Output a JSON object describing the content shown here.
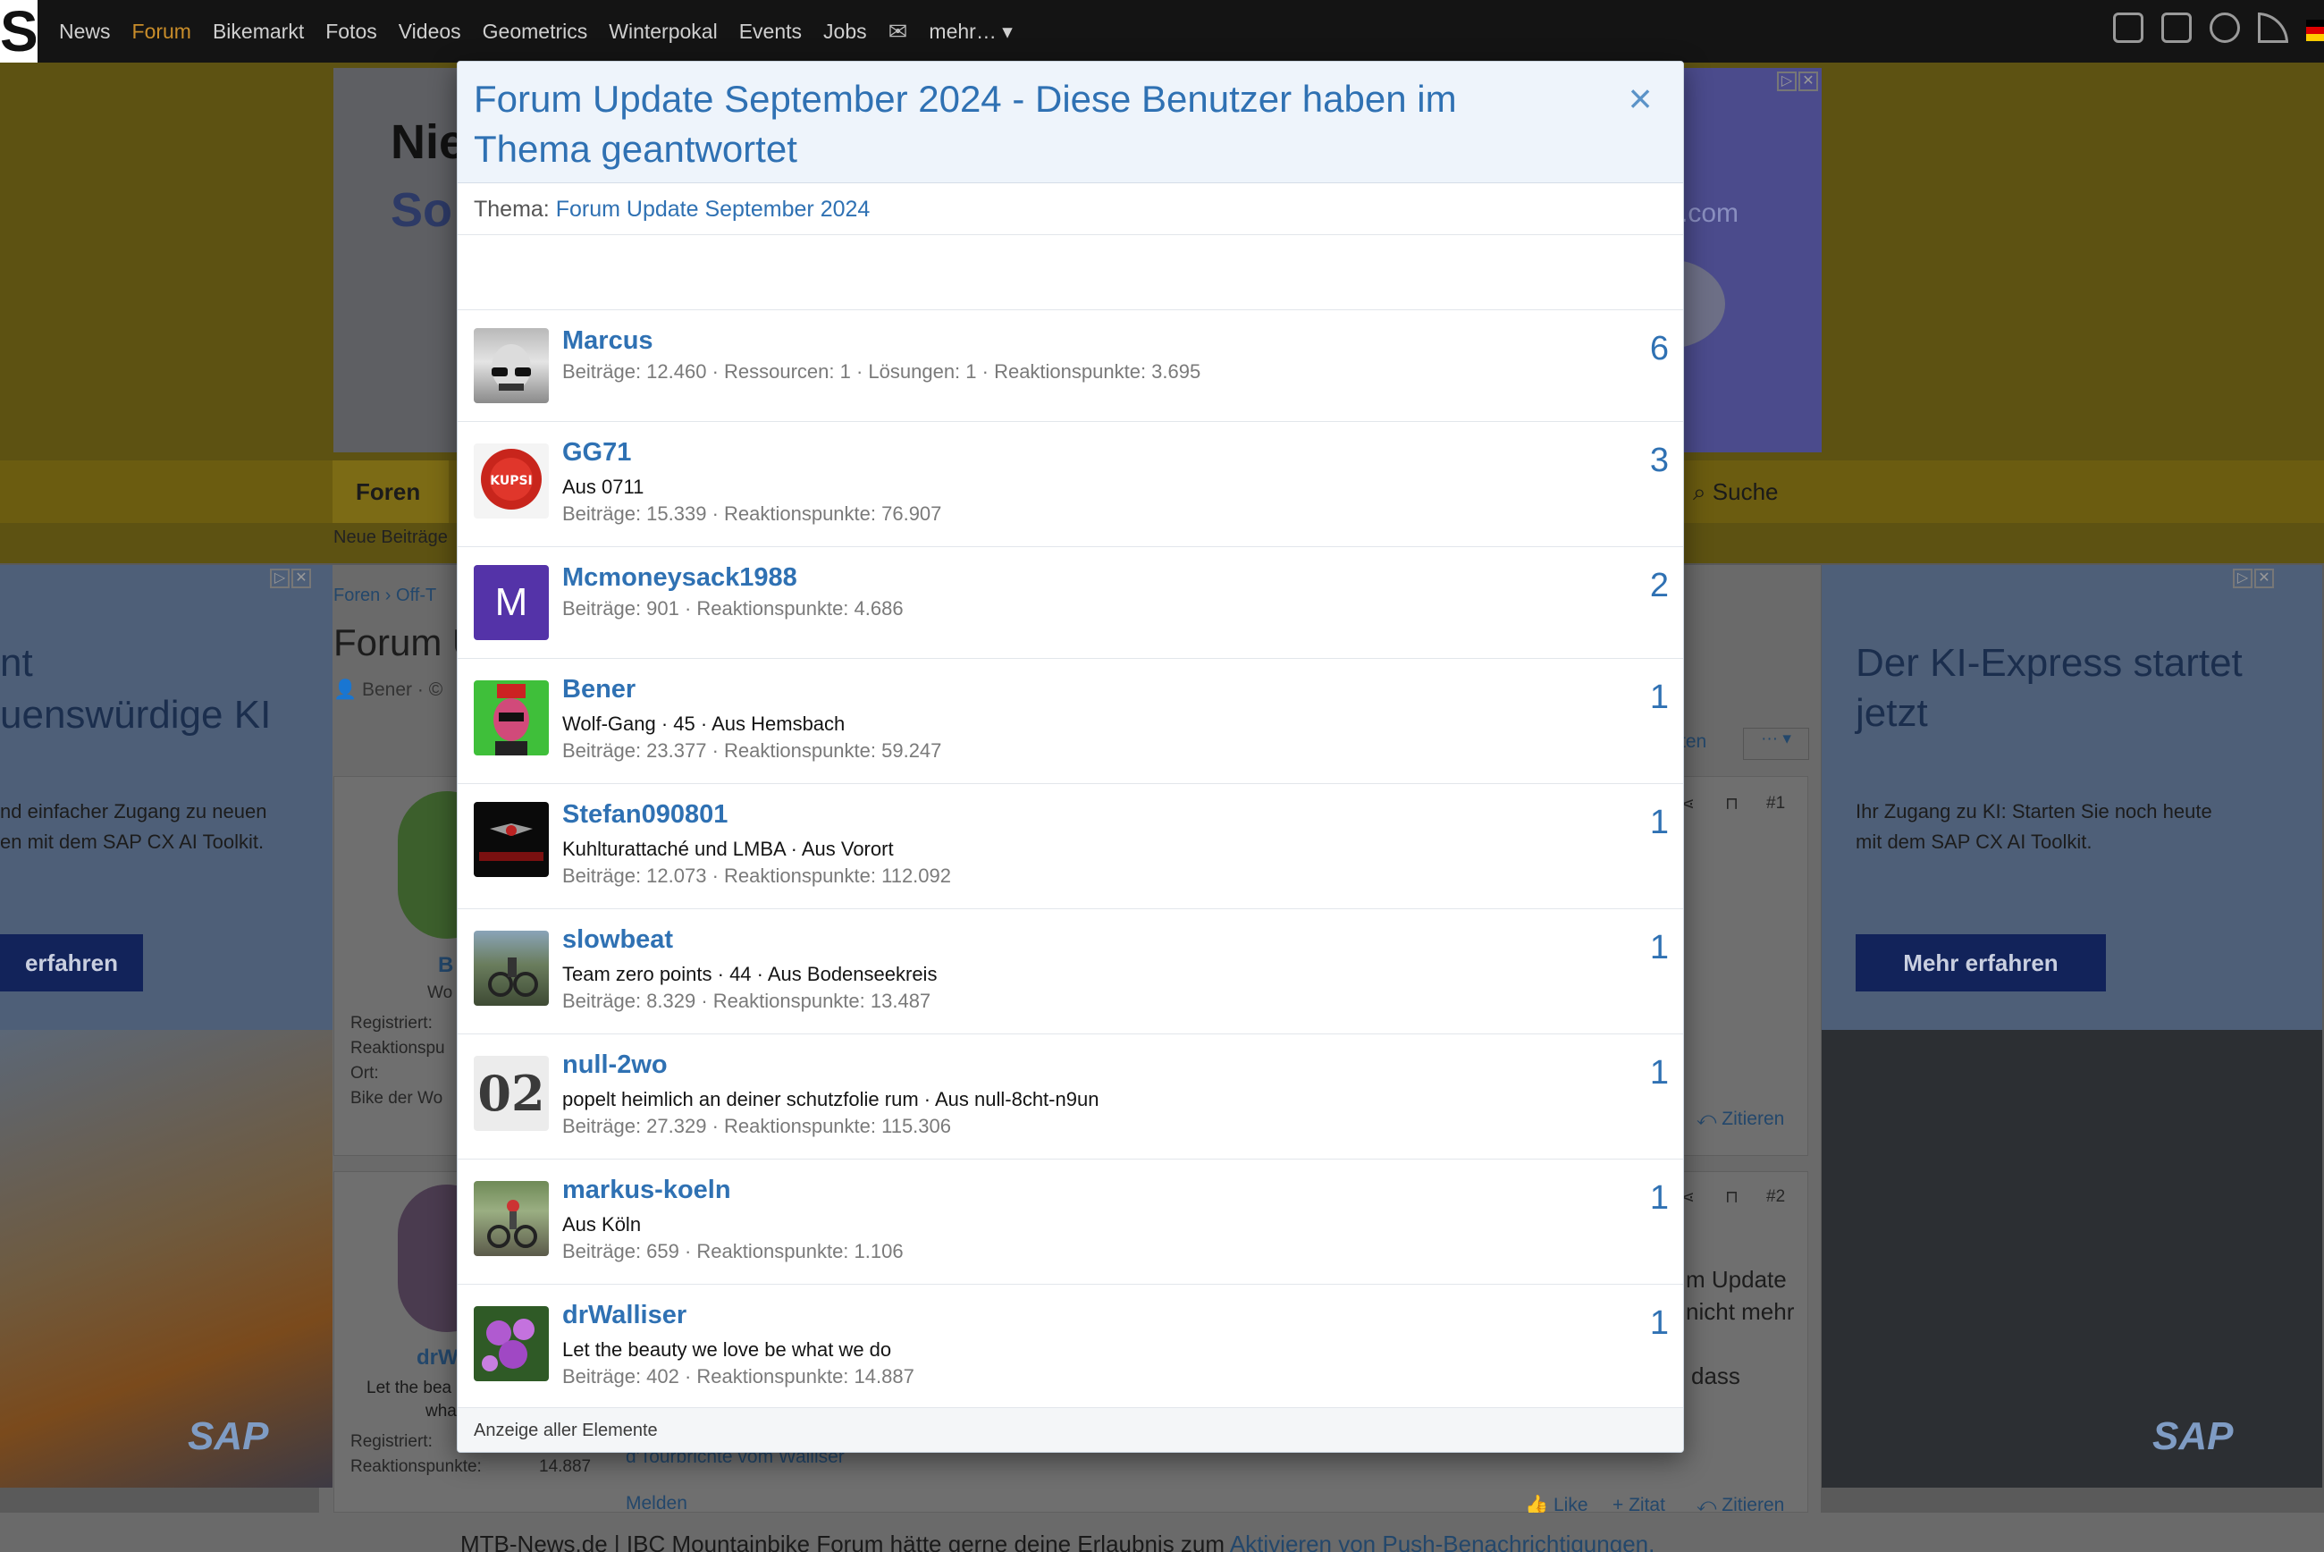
{
  "nav": {
    "logo": "S",
    "items": [
      "News",
      "Forum",
      "Bikemarkt",
      "Fotos",
      "Videos",
      "Geometrics",
      "Winterpokal",
      "Events",
      "Jobs"
    ],
    "more": "mehr…",
    "active": "Forum"
  },
  "banner": {
    "line1": "Nie",
    "line2": "So",
    "domain": ".com"
  },
  "forumnav": {
    "foren": "Foren",
    "suche": "Suche",
    "neue": "Neue Beiträge"
  },
  "page": {
    "breadcrumb": "Foren  ›  Off-T",
    "title": "Forum U",
    "meta": "Bener · ©",
    "post1_user": "B",
    "post1_user_sub": "Wo",
    "post1_labels": [
      "Registriert:",
      "Reaktionspu",
      "Ort:",
      "Bike der Wo"
    ],
    "post2_user": "drW",
    "post2_sub1": "Let the bea",
    "post2_sub2": "wha",
    "post2_labels": [
      "Registriert:",
      "Reaktionspunkte:"
    ],
    "post2_points": "14.887",
    "post2_sig": "d'Tourbrichte vom Walliser",
    "melden": "Melden",
    "like": "Like",
    "zitat": "+ Zitat",
    "zitieren": "Zitieren",
    "post_num1": "#1",
    "post_num2": "#2",
    "side_text1": "m Update",
    "side_text2": "nicht mehr",
    "side_text3": "dass",
    "ten": "ten"
  },
  "ads": {
    "left_title1": "nt",
    "left_title2": "uenswürdige KI",
    "left_sub1": "nd einfacher Zugang zu neuen",
    "left_sub2": "en mit dem SAP CX AI Toolkit.",
    "left_btn": "erfahren",
    "right_title1": "Der KI-Express startet",
    "right_title2": "jetzt",
    "right_sub1": "Ihr Zugang zu KI: Starten Sie noch heute",
    "right_sub2": "mit dem SAP CX AI Toolkit.",
    "right_btn": "Mehr erfahren",
    "sap": "SAP"
  },
  "bottombar": {
    "text": "MTB-News.de | IBC Mountainbike Forum hätte gerne deine Erlaubnis zum ",
    "link": "Aktivieren von Push-Benachrichtigungen."
  },
  "modal": {
    "title": "Forum Update September 2024 - Diese Benutzer haben im Thema geantwortet",
    "close": "×",
    "topic_label": "Thema:",
    "topic_link": "Forum Update September 2024",
    "footer": "Anzeige aller Elemente",
    "users": [
      {
        "name": "Marcus",
        "title": "",
        "stats": "Beiträge: 12.460 · Ressourcen: 1 · Lösungen: 1 · Reaktionspunkte: 3.695",
        "count": "6"
      },
      {
        "name": "GG71",
        "title": "Aus 0711",
        "stats": "Beiträge: 15.339 · Reaktionspunkte: 76.907",
        "count": "3"
      },
      {
        "name": "Mcmoneysack1988",
        "title": "",
        "stats": "Beiträge: 901 · Reaktionspunkte: 4.686",
        "count": "2",
        "initial": "M"
      },
      {
        "name": "Bener",
        "title": "Wolf-Gang · 45 · Aus Hemsbach",
        "stats": "Beiträge: 23.377 · Reaktionspunkte: 59.247",
        "count": "1"
      },
      {
        "name": "Stefan090801",
        "title": "Kuhlturattaché und LMBA · Aus Vorort",
        "stats": "Beiträge: 12.073 · Reaktionspunkte: 112.092",
        "count": "1"
      },
      {
        "name": "slowbeat",
        "title": "Team zero points · 44 · Aus Bodenseekreis",
        "stats": "Beiträge: 8.329 · Reaktionspunkte: 13.487",
        "count": "1"
      },
      {
        "name": "null-2wo",
        "title": "popelt heimlich an deiner schutzfolie rum · Aus null-8cht-n9un",
        "stats": "Beiträge: 27.329 · Reaktionspunkte: 115.306",
        "count": "1",
        "initial": "02"
      },
      {
        "name": "markus-koeln",
        "title": "Aus Köln",
        "stats": "Beiträge: 659 · Reaktionspunkte: 1.106",
        "count": "1"
      },
      {
        "name": "drWalliser",
        "title": "Let the beauty we love be what we do",
        "stats": "Beiträge: 402 · Reaktionspunkte: 14.887",
        "count": "1"
      }
    ]
  }
}
